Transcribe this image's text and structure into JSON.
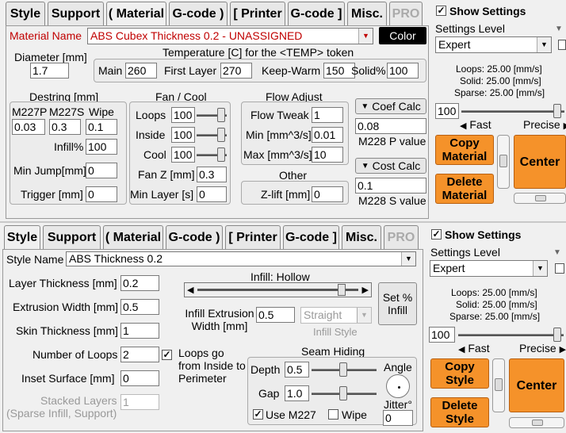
{
  "top": {
    "tabs": [
      "Style",
      "Support",
      "( Material",
      "G-code )",
      "[ Printer",
      "G-code ]",
      "Misc.",
      "PRO"
    ],
    "material_name_label": "Material Name",
    "material_name_value": "ABS Cubex Thickness 0.2 - UNASSIGNED",
    "color_button": "Color",
    "diameter_label": "Diameter [mm]",
    "diameter_value": "1.7",
    "temp_title": "Temperature [C] for the <TEMP> token",
    "temp_main_label": "Main",
    "temp_main_value": "260",
    "temp_first_label": "First Layer",
    "temp_first_value": "270",
    "temp_keep_label": "Keep-Warm",
    "temp_keep_value": "150",
    "temp_solid_label": "Solid%",
    "temp_solid_value": "100",
    "destring_title": "Destring [mm]",
    "m227p_label": "M227P",
    "m227s_label": "M227S",
    "wipe_label": "Wipe",
    "m227p_value": "0.03",
    "m227s_value": "0.3",
    "wipe_value": "0.1",
    "infill_pct_label": "Infill%",
    "infill_pct_value": "100",
    "min_jump_label": "Min Jump[mm]",
    "min_jump_value": "0",
    "trigger_label": "Trigger [mm]",
    "trigger_value": "0",
    "fan_title": "Fan / Cool",
    "fan_loops_label": "Loops",
    "fan_loops_value": "100",
    "fan_inside_label": "Inside",
    "fan_inside_value": "100",
    "fan_cool_label": "Cool",
    "fan_cool_value": "100",
    "fan_z_label": "Fan Z [mm]",
    "fan_z_value": "0.3",
    "min_layer_label": "Min Layer [s]",
    "min_layer_value": "0",
    "flow_title": "Flow Adjust",
    "flow_tweak_label": "Flow Tweak",
    "flow_tweak_value": "1",
    "flow_min_label": "Min [mm^3/s]",
    "flow_min_value": "0.01",
    "flow_max_label": "Max [mm^3/s]",
    "flow_max_value": "10",
    "other_title": "Other",
    "zlift_label": "Z-lift [mm]",
    "zlift_value": "0",
    "coef_calc": "Coef Calc",
    "m228p_value": "0.08",
    "m228p_label": "M228 P value",
    "cost_calc": "Cost Calc",
    "m228s_value": "0.1",
    "m228s_label": "M228 S value"
  },
  "right_top": {
    "show_settings": "Show Settings",
    "settings_level_label": "Settings Level",
    "settings_level_value": "Expert",
    "loops_speed": "Loops:  25.00 [mm/s]",
    "solid_speed": "Solid:  25.00 [mm/s]",
    "sparse_speed": "Sparse: 25.00 [mm/s]",
    "speed_value": "100",
    "fast_label": "Fast",
    "precise_label": "Precise",
    "copy_button": "Copy Material",
    "center_button": "Center",
    "delete_button": "Delete Material"
  },
  "bottom": {
    "tabs": [
      "Style",
      "Support",
      "( Material",
      "G-code )",
      "[ Printer",
      "G-code ]",
      "Misc.",
      "PRO"
    ],
    "style_name_label": "Style Name",
    "style_name_value": "ABS Thickness 0.2",
    "layer_thickness_label": "Layer Thickness [mm]",
    "layer_thickness_value": "0.2",
    "extrusion_width_label": "Extrusion Width [mm]",
    "extrusion_width_value": "0.5",
    "skin_thickness_label": "Skin Thickness [mm]",
    "skin_thickness_value": "1",
    "num_loops_label": "Number of Loops",
    "num_loops_value": "2",
    "loops_go_label": "Loops go from Inside to Perimeter",
    "inset_surface_label": "Inset  Surface [mm]",
    "inset_surface_value": "0",
    "stacked_label": "Stacked Layers",
    "stacked_sub": "(Sparse Infill, Support)",
    "stacked_value": "1",
    "infill_title": "Infill: Hollow",
    "infill_extrusion_label": "Infill Extrusion Width [mm]",
    "infill_extrusion_value": "0.5",
    "infill_style_value": "Straight",
    "infill_style_label": "Infill Style",
    "set_infill": "Set % Infill",
    "seam_title": "Seam Hiding",
    "depth_label": "Depth",
    "depth_value": "0.5",
    "gap_label": "Gap",
    "gap_value": "1.0",
    "angle_label": "Angle",
    "jitter_label": "Jitter°",
    "jitter_value": "0",
    "use_m227": "Use M227",
    "wipe_label": "Wipe"
  },
  "right_bottom": {
    "show_settings": "Show Settings",
    "settings_level_label": "Settings Level",
    "settings_level_value": "Expert",
    "loops_speed": "Loops:  25.00 [mm/s]",
    "solid_speed": "Solid:  25.00 [mm/s]",
    "sparse_speed": "Sparse: 25.00 [mm/s]",
    "speed_value": "100",
    "fast_label": "Fast",
    "precise_label": "Precise",
    "copy_button": "Copy Style",
    "center_button": "Center",
    "delete_button": "Delete Style"
  },
  "colors": {
    "accent": "#f5922a",
    "label_red": "#c00000"
  }
}
